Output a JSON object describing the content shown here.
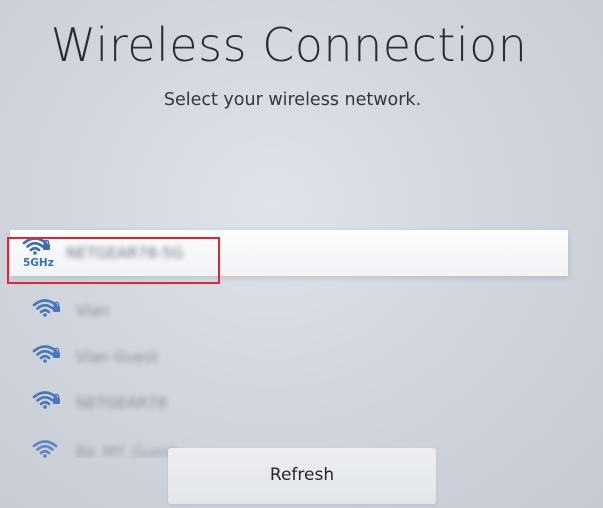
{
  "screen": {
    "title": "Wireless Connection",
    "subtitle": "Select your wireless network."
  },
  "networks": [
    {
      "name": "NETGEAR78-5G",
      "band": "5GHz",
      "secured": true,
      "selected": true,
      "icon": "wifi-lock-icon"
    },
    {
      "name": "Vlan",
      "band": "",
      "secured": true,
      "selected": false,
      "icon": "wifi-lock-icon"
    },
    {
      "name": "Vlan Guest",
      "band": "",
      "secured": true,
      "selected": false,
      "icon": "wifi-lock-icon"
    },
    {
      "name": "NETGEAR78",
      "band": "",
      "secured": true,
      "selected": false,
      "icon": "wifi-lock-icon"
    },
    {
      "name": "Be_MY_Guest",
      "band": "",
      "secured": true,
      "selected": false,
      "icon": "wifi-lock-icon"
    }
  ],
  "actions": {
    "refresh_label": "Refresh"
  },
  "colors": {
    "focus_border": "#e0262f",
    "wifi_icon": "#3b6fb5",
    "selected_row": "#f5f6f8"
  }
}
